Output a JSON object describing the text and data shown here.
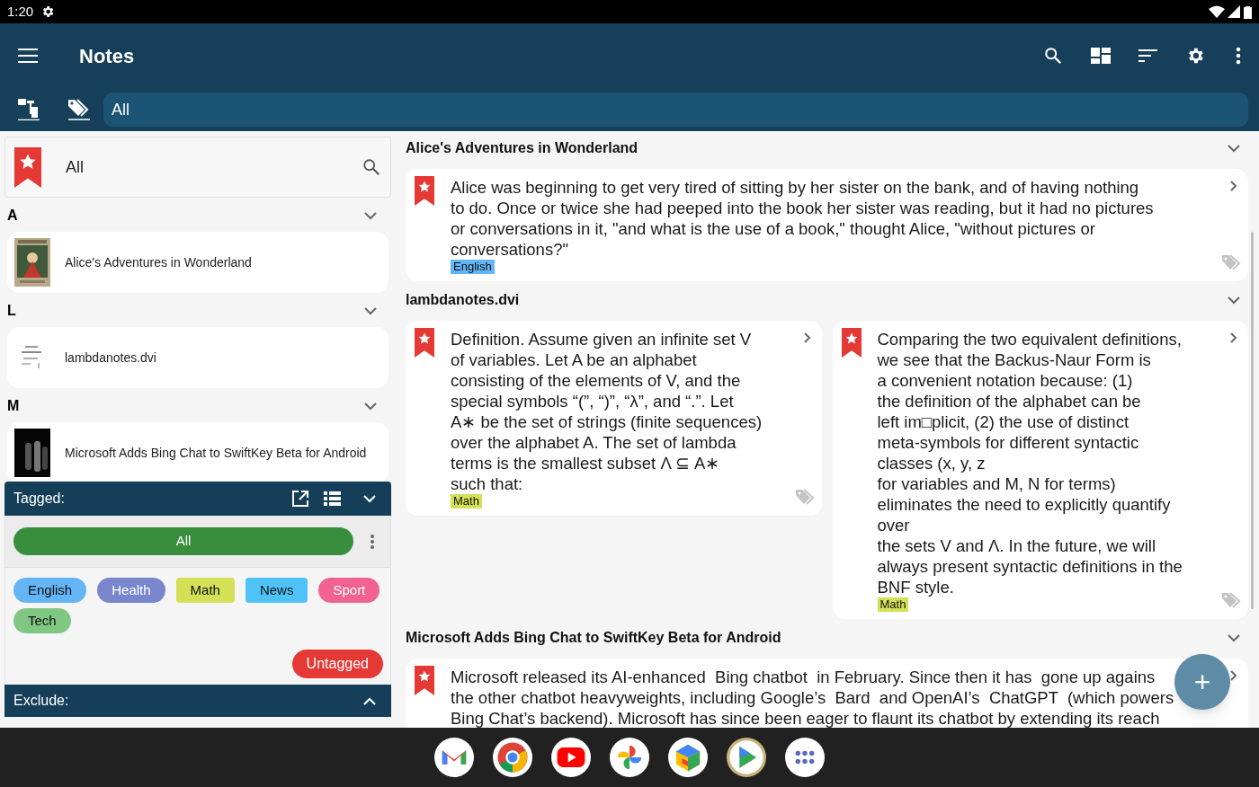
{
  "status_bar": {
    "time": "1:20"
  },
  "app_bar": {
    "title": "Notes"
  },
  "filter_bar": {
    "value": "All"
  },
  "sidebar": {
    "header": {
      "label": "All"
    },
    "sections": [
      {
        "letter": "A",
        "items": [
          {
            "title": "Alice's Adventures in Wonderland"
          }
        ]
      },
      {
        "letter": "L",
        "items": [
          {
            "title": "lambdanotes.dvi"
          }
        ]
      },
      {
        "letter": "M",
        "items": [
          {
            "title": "Microsoft Adds Bing Chat to SwiftKey Beta for Android"
          }
        ]
      }
    ],
    "tagged": {
      "label": "Tagged:",
      "expanded": true,
      "all_button": "All",
      "tags": [
        {
          "label": "English",
          "color": "#64b5f6"
        },
        {
          "label": "Health",
          "color": "#7986cb"
        },
        {
          "label": "Math",
          "color": "#d4e157"
        },
        {
          "label": "News",
          "color": "#4fc3f7"
        },
        {
          "label": "Sport",
          "color": "#f06292"
        },
        {
          "label": "Tech",
          "color": "#81c784"
        }
      ],
      "untagged": "Untagged"
    },
    "exclude": {
      "label": "Exclude:",
      "expanded": false
    }
  },
  "note_groups": [
    {
      "title": "Alice's Adventures in Wonderland",
      "notes": [
        {
          "lines": [
            "Alice was beginning to get very tired of sitting by her sister on the bank, and of having nothing",
            "to do. Once or twice she had peeped into the book her sister was reading, but it had no pictures",
            "or conversations in it, \"and what is the use of a book,\" thought Alice, \"without pictures or",
            "conversations?\""
          ],
          "tag": {
            "label": "English",
            "color": "#64b5f6"
          }
        }
      ]
    },
    {
      "title": "lambdanotes.dvi",
      "notes": [
        {
          "lines": [
            "Definition. Assume given an infinite set V",
            "of variables. Let A be an alphabet",
            "consisting of the elements of V, and the",
            "special symbols “(”, “)”, “λ”, and “.”. Let",
            "A∗ be the set of strings (finite sequences)",
            "over the alphabet A. The set of lambda",
            "terms is the smallest subset Λ ⊆ A∗",
            "such that:"
          ],
          "tag": {
            "label": "Math",
            "color": "#d4e157"
          }
        },
        {
          "lines": [
            "Comparing the two equivalent definitions,",
            "we see that the Backus-Naur Form is",
            "a convenient notation because: (1)",
            "the definition of the alphabet can be",
            "left im□plicit, (2) the use of distinct",
            "meta-symbols for different syntactic",
            "classes (x, y, z",
            "for variables and M, N for terms)",
            "eliminates the need to explicitly quantify",
            "over",
            "the sets V and Λ. In the future, we will",
            "always present syntactic definitions in the",
            "BNF style."
          ],
          "tag": {
            "label": "Math",
            "color": "#d4e157"
          }
        }
      ]
    },
    {
      "title": "Microsoft Adds Bing Chat to SwiftKey Beta for Android",
      "notes": [
        {
          "lines": [
            "Microsoft released its AI-enhanced  Bing chatbot  in February. Since then it has  gone up agains",
            "the other chatbot heavyweights, including Google’s  Bard  and OpenAI’s  ChatGPT  (which powers",
            "Bing Chat’s backend). Microsoft has since been eager to flaunt its chatbot by extending its reach"
          ]
        }
      ]
    }
  ],
  "fab": {
    "symbol": "+"
  }
}
